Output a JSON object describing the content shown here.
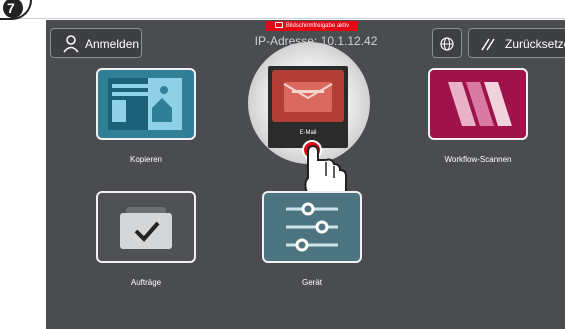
{
  "step": "7",
  "banner": "Bildschirmfreigabe aktiv",
  "header": {
    "login_label": "Anmelden",
    "ip_text": "IP-Adresse: 10.1.12.42",
    "reset_label": "Zurücksetzen"
  },
  "tiles": {
    "copy": "Kopieren",
    "email": "E-Mail",
    "workflow": "Workflow-Scannen",
    "jobs": "Aufträge",
    "device": "Gerät"
  },
  "colors": {
    "screen_bg": "#4a4c4f",
    "banner_red": "#e30613",
    "copy_tile": "#2f7f96",
    "email_tile": "#b33e35",
    "workflow_tile": "#a0134a",
    "device_tile": "#4d7481"
  }
}
